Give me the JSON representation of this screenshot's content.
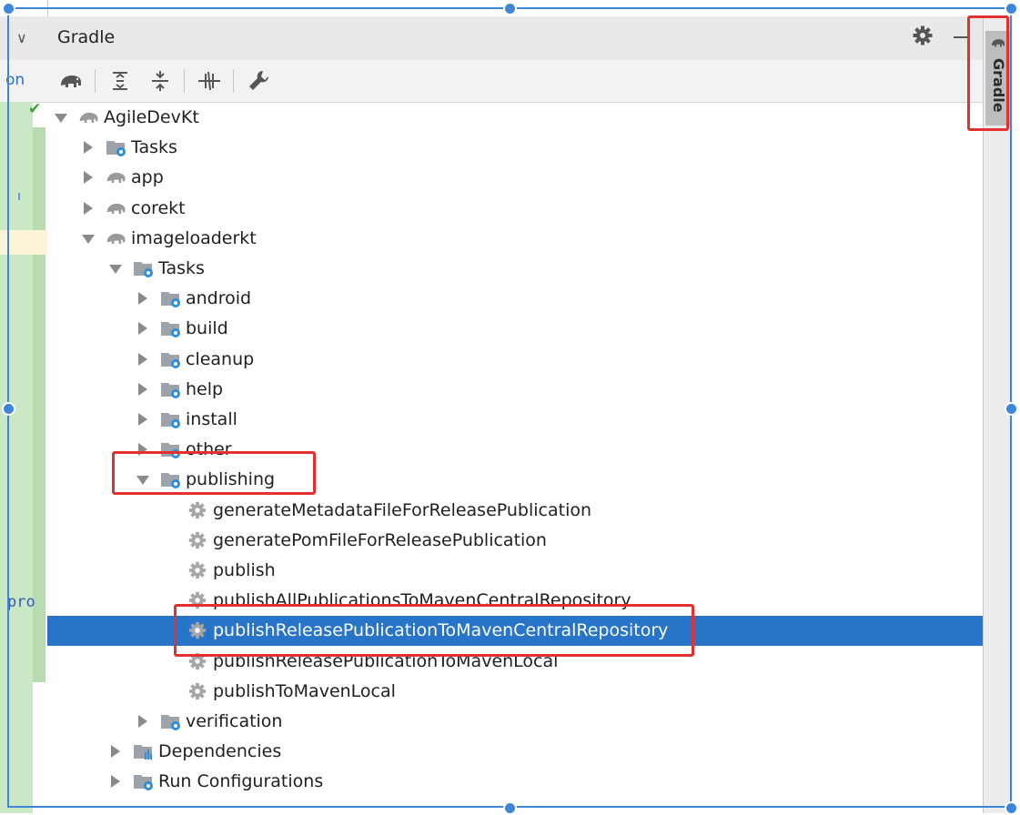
{
  "editor": {
    "partial_text_top": "on",
    "partial_text_code": "pro"
  },
  "panel": {
    "title": "Gradle",
    "toolbar": [
      "elephant-icon",
      "expand-all-icon",
      "collapse-all-icon",
      "toggle-offline-icon",
      "wrench-icon"
    ],
    "side_label": "Gradle"
  },
  "tree": [
    {
      "label": "AgileDevKt",
      "level": 0,
      "arrow": "down",
      "icon": "elephant"
    },
    {
      "label": "Tasks",
      "level": 1,
      "arrow": "right",
      "icon": "folder-gear"
    },
    {
      "label": "app",
      "level": 1,
      "arrow": "right",
      "icon": "elephant"
    },
    {
      "label": "corekt",
      "level": 1,
      "arrow": "right",
      "icon": "elephant"
    },
    {
      "label": "imageloaderkt",
      "level": 1,
      "arrow": "down",
      "icon": "elephant"
    },
    {
      "label": "Tasks",
      "level": 2,
      "arrow": "down",
      "icon": "folder-gear"
    },
    {
      "label": "android",
      "level": 3,
      "arrow": "right",
      "icon": "folder-gear"
    },
    {
      "label": "build",
      "level": 3,
      "arrow": "right",
      "icon": "folder-gear"
    },
    {
      "label": "cleanup",
      "level": 3,
      "arrow": "right",
      "icon": "folder-gear"
    },
    {
      "label": "help",
      "level": 3,
      "arrow": "right",
      "icon": "folder-gear"
    },
    {
      "label": "install",
      "level": 3,
      "arrow": "right",
      "icon": "folder-gear"
    },
    {
      "label": "other",
      "level": 3,
      "arrow": "right",
      "icon": "folder-gear"
    },
    {
      "label": "publishing",
      "level": 3,
      "arrow": "down",
      "icon": "folder-gear"
    },
    {
      "label": "generateMetadataFileForReleasePublication",
      "level": 4,
      "arrow": "none",
      "icon": "gear"
    },
    {
      "label": "generatePomFileForReleasePublication",
      "level": 4,
      "arrow": "none",
      "icon": "gear"
    },
    {
      "label": "publish",
      "level": 4,
      "arrow": "none",
      "icon": "gear"
    },
    {
      "label": "publishAllPublicationsToMavenCentralRepository",
      "level": 4,
      "arrow": "none",
      "icon": "gear"
    },
    {
      "label": "publishReleasePublicationToMavenCentralRepository",
      "level": 4,
      "arrow": "none",
      "icon": "gear",
      "selected": true
    },
    {
      "label": "publishReleasePublicationToMavenLocal",
      "level": 4,
      "arrow": "none",
      "icon": "gear"
    },
    {
      "label": "publishToMavenLocal",
      "level": 4,
      "arrow": "none",
      "icon": "gear"
    },
    {
      "label": "verification",
      "level": 3,
      "arrow": "right",
      "icon": "folder-gear"
    },
    {
      "label": "Dependencies",
      "level": 2,
      "arrow": "right",
      "icon": "folder-deps"
    },
    {
      "label": "Run Configurations",
      "level": 2,
      "arrow": "right",
      "icon": "folder-gear"
    }
  ],
  "colors": {
    "selection": "#2874c8",
    "annotation": "#e53030",
    "frame": "#3f86d8"
  }
}
